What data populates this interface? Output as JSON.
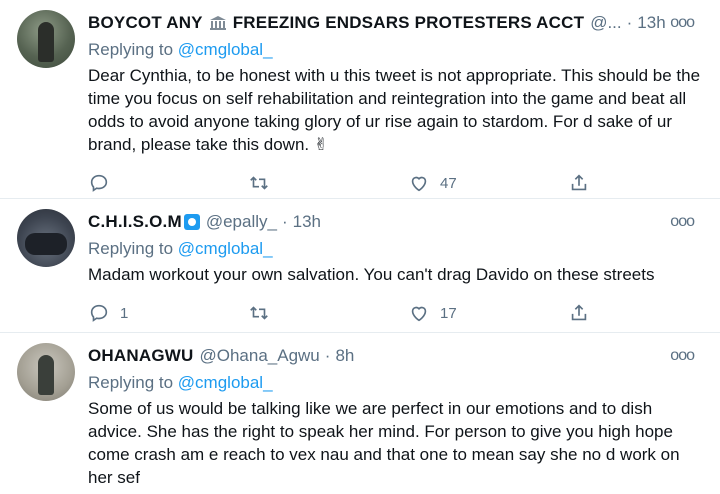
{
  "tweets": [
    {
      "name_part1": "BOYCOT ANY",
      "name_part2": "FREEZING ENDSARS PROTESTERS ACCT",
      "handle": "@...",
      "time": "13h",
      "replying_label": "Replying to",
      "replying_to": "@cmglobal_",
      "text": "Dear Cynthia, to be honest with u this tweet is not appropriate. This should be the time you focus on self rehabilitation and reintegration into the game and beat all odds to avoid anyone taking glory of ur rise again to stardom. For d sake of ur brand, please take this down. ✌",
      "replies": "",
      "retweets": "",
      "likes": "47"
    },
    {
      "name": "C.H.I.S.O.M",
      "handle": "@epally_",
      "time": "13h",
      "replying_label": "Replying to",
      "replying_to": "@cmglobal_",
      "text": "Madam workout your own salvation. You can't drag Davido on these streets",
      "replies": "1",
      "retweets": "",
      "likes": "17"
    },
    {
      "name": "OHANAGWU",
      "handle": "@Ohana_Agwu",
      "time": "8h",
      "replying_label": "Replying to",
      "replying_to": "@cmglobal_",
      "text": "Some of us would be talking like we are perfect in our emotions and to dish advice. She has the right to speak her mind. For person to give you high hope come crash am e reach to vex nau and that one to mean say she no d work on her sef"
    }
  ],
  "separator": "·",
  "more_glyph": "ooo",
  "colors": {
    "link": "#1d9bf0",
    "muted": "#5b7083",
    "text": "#0f1419",
    "border": "#e6ecf0"
  }
}
